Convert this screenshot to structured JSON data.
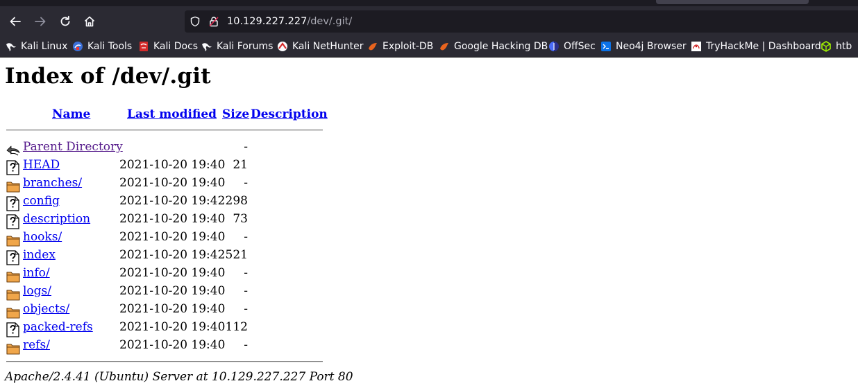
{
  "browser": {
    "url_host": "10.129.227.227",
    "url_path": "/dev/.git/",
    "bookmarks": [
      {
        "label": "Kali Linux",
        "icon": "kali-dragon-icon"
      },
      {
        "label": "Kali Tools",
        "icon": "kali-tools-icon"
      },
      {
        "label": "Kali Docs",
        "icon": "kali-docs-icon"
      },
      {
        "label": "Kali Forums",
        "icon": "kali-dragon-icon"
      },
      {
        "label": "Kali NetHunter",
        "icon": "nethunter-icon"
      },
      {
        "label": "Exploit-DB",
        "icon": "exploit-db-icon"
      },
      {
        "label": "Google Hacking DB",
        "icon": "exploit-db-icon"
      },
      {
        "label": "OffSec",
        "icon": "offsec-icon"
      },
      {
        "label": "Neo4j Browser",
        "icon": "terminal-icon"
      },
      {
        "label": "TryHackMe | Dashboard",
        "icon": "tryhackme-icon"
      },
      {
        "label": "htb",
        "icon": "cube-icon"
      }
    ]
  },
  "page": {
    "title": "Index of /dev/.git",
    "columns": {
      "name": "Name",
      "last_modified": "Last modified",
      "size": "Size",
      "description": "Description"
    },
    "entries": [
      {
        "name": "Parent Directory",
        "modified": "",
        "size": "-",
        "icon": "back-arrow-icon"
      },
      {
        "name": "HEAD",
        "modified": "2021-10-20 19:40",
        "size": "21",
        "icon": "unknown-file-icon"
      },
      {
        "name": "branches/",
        "modified": "2021-10-20 19:40",
        "size": "-",
        "icon": "folder-icon"
      },
      {
        "name": "config",
        "modified": "2021-10-20 19:42",
        "size": "298",
        "icon": "unknown-file-icon"
      },
      {
        "name": "description",
        "modified": "2021-10-20 19:40",
        "size": "73",
        "icon": "unknown-file-icon"
      },
      {
        "name": "hooks/",
        "modified": "2021-10-20 19:40",
        "size": "-",
        "icon": "folder-icon"
      },
      {
        "name": "index",
        "modified": "2021-10-20 19:42",
        "size": "521",
        "icon": "unknown-file-icon"
      },
      {
        "name": "info/",
        "modified": "2021-10-20 19:40",
        "size": "-",
        "icon": "folder-icon"
      },
      {
        "name": "logs/",
        "modified": "2021-10-20 19:40",
        "size": "-",
        "icon": "folder-icon"
      },
      {
        "name": "objects/",
        "modified": "2021-10-20 19:40",
        "size": "-",
        "icon": "folder-icon"
      },
      {
        "name": "packed-refs",
        "modified": "2021-10-20 19:40",
        "size": "112",
        "icon": "unknown-file-icon"
      },
      {
        "name": "refs/",
        "modified": "2021-10-20 19:40",
        "size": "-",
        "icon": "folder-icon"
      }
    ],
    "footer": "Apache/2.4.41 (Ubuntu) Server at 10.129.227.227 Port 80"
  }
}
